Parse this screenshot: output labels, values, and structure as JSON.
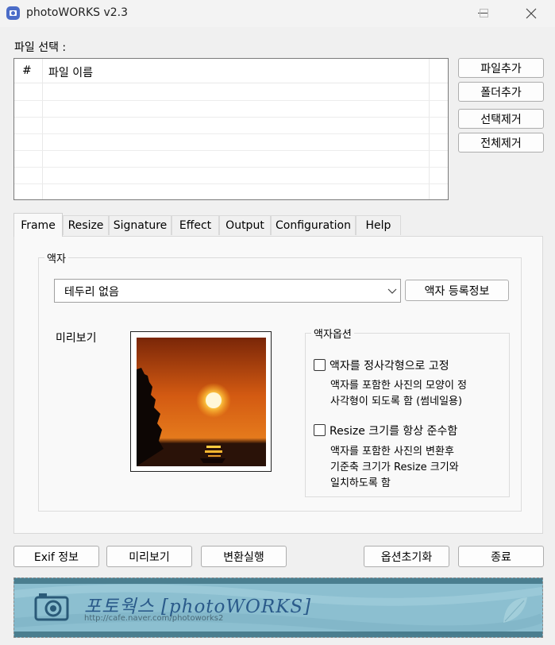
{
  "window": {
    "title": "photoWORKS v2.3"
  },
  "file_section": {
    "label": "파일 선택 :",
    "columns": [
      "#",
      "파일 이름"
    ],
    "rows": [],
    "buttons": {
      "add_file": "파일추가",
      "add_folder": "폴더추가",
      "remove_selected": "선택제거",
      "remove_all": "전체제거"
    }
  },
  "tabs": [
    "Frame",
    "Resize",
    "Signature",
    "Effect",
    "Output",
    "Configuration",
    "Help"
  ],
  "active_tab": "Frame",
  "frame_panel": {
    "group_label": "액자",
    "frame_select": {
      "value": "테두리 없음"
    },
    "frame_info_button": "액자 등록정보",
    "preview_label": "미리보기",
    "options": {
      "group_label": "액자옵션",
      "square": {
        "label": "액자를 정사각형으로 고정",
        "checked": false,
        "desc_line1": "액자를 포함한 사진의 모양이 정",
        "desc_line2": "사각형이 되도록 함 (썸네일용)"
      },
      "resize": {
        "label": "Resize 크기를 항상 준수함",
        "checked": false,
        "desc_line1": "액자를 포함한 사진의 변환후",
        "desc_line2": "기준축 크기가 Resize 크기와",
        "desc_line3": "일치하도록 함"
      }
    }
  },
  "bottom_buttons": {
    "exif": "Exif 정보",
    "preview": "미리보기",
    "convert": "변환실행",
    "reset_options": "옵션초기화",
    "exit": "종료"
  },
  "banner": {
    "title": "포토웍스 [photoWORKS]",
    "url": "http://cafe.naver.com/photoworks2"
  },
  "colors": {
    "banner_bg": "#8cbfd0",
    "title_bar": "#f3f3f3",
    "app_icon": "#4b6cc8"
  }
}
